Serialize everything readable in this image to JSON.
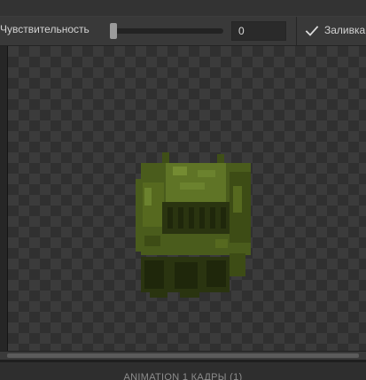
{
  "toolbar": {
    "sensitivity_label": "Чувствительность",
    "sensitivity_value": "0",
    "sensitivity_level": 0,
    "fill_label": "Заливка",
    "fill_checked": true
  },
  "icons": {
    "fill_check": "checkmark-icon"
  },
  "canvas": {
    "sprite": "green-backpack-sprite",
    "background": "transparency-checkerboard"
  },
  "timeline": {
    "title": "ANIMATION 1 КАДРЫ (1)"
  },
  "colors": {
    "sprite_dark": "#2a3410",
    "sprite_mid": "#4a5c1c",
    "sprite_light": "#5f7426",
    "sprite_highlight": "#748b32"
  }
}
